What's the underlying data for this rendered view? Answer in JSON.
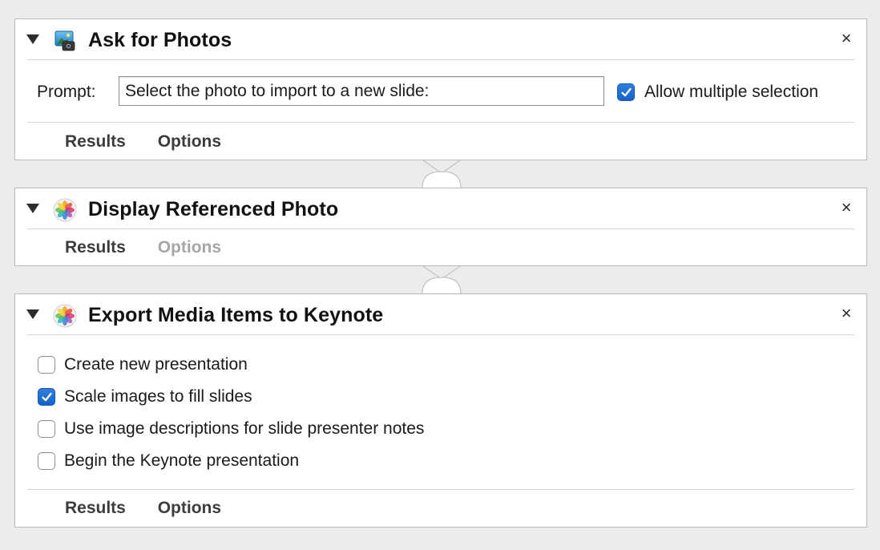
{
  "actions": [
    {
      "title": "Ask for Photos",
      "icon": "iphoto-icon",
      "prompt_label": "Prompt:",
      "prompt_value": "Select the photo to import to a new slide:",
      "allow_multiple_label": "Allow multiple selection",
      "allow_multiple_checked": true,
      "tabs": {
        "results": "Results",
        "options": "Options"
      },
      "options_enabled": true
    },
    {
      "title": "Display Referenced Photo",
      "icon": "photos-icon",
      "tabs": {
        "results": "Results",
        "options": "Options"
      },
      "options_enabled": false
    },
    {
      "title": "Export Media Items to Keynote",
      "icon": "photos-icon",
      "checkboxes": [
        {
          "label": "Create new presentation",
          "checked": false
        },
        {
          "label": "Scale images to fill slides",
          "checked": true
        },
        {
          "label": "Use image descriptions for slide presenter notes",
          "checked": false
        },
        {
          "label": "Begin the Keynote presentation",
          "checked": false
        }
      ],
      "tabs": {
        "results": "Results",
        "options": "Options"
      },
      "options_enabled": true
    }
  ],
  "close_glyph": "×",
  "colors": {
    "background": "#ececec",
    "panel": "#ffffff",
    "checkbox_accent": "#1a6ad6",
    "disabled_text": "#a6a6a6"
  }
}
